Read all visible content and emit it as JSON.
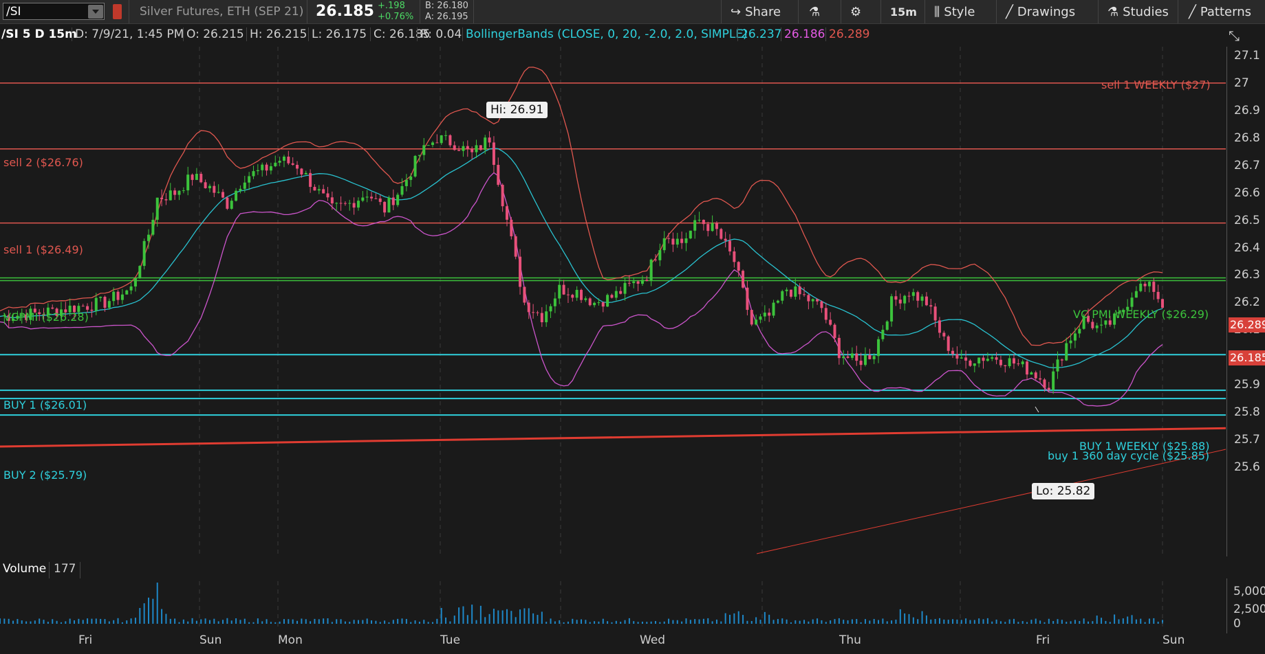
{
  "toolbar": {
    "symbol": "/SI",
    "description": "Silver Futures, ETH (SEP 21)",
    "last": "26.185",
    "change": "+.198",
    "change_pct": "+0.76%",
    "bid": "B: 26.180",
    "ask": "A: 26.195",
    "share_label": "Share",
    "timeframe_label": "15m",
    "style_label": "Style",
    "drawings_label": "Drawings",
    "studies_label": "Studies",
    "patterns_label": "Patterns",
    "icons": [
      "share-icon",
      "flask-icon",
      "gear-icon",
      "style-icon",
      "drawings-icon",
      "studies-icon",
      "patterns-icon"
    ]
  },
  "infobar": {
    "symbol_period": "/SI 5 D 15m",
    "date": "D: 7/9/21, 1:45 PM",
    "open": "O: 26.215",
    "high": "H: 26.215",
    "low": "L: 26.175",
    "close": "C: 26.185",
    "range": "R: 0.04",
    "study": "BollingerBands (CLOSE, 0, 20, -2.0, 2.0, SIMPLE)",
    "study_mid": "26.237",
    "study_lower": "26.186",
    "study_upper": "26.289"
  },
  "levels": {
    "sell1_weekly": "sell 1 WEEKLY ($27)",
    "sell2": "sell 2  ($26.76)",
    "sell1": "sell 1 ($26.49)",
    "vcpmi": "VCPMI ($26.28)",
    "vcpmi_weekly": "VC PMI WEEKLY ($26.29)",
    "buy1": "BUY 1 ($26.01)",
    "buy1_weekly": "BUY 1 WEEKLY ($25.88)",
    "buy1_cycle": "buy 1 360 day cycle  ($25.85)",
    "buy2": "BUY 2 ($25.79)"
  },
  "annotations": {
    "hi": "Hi: 26.91",
    "lo": "Lo: 25.82"
  },
  "price_tags": {
    "upper": "26.289",
    "last": "26.185"
  },
  "volume": {
    "label": "Volume",
    "count": "177",
    "ticks": [
      "5,000",
      "2,500",
      "0"
    ]
  },
  "colors": {
    "upper_band": "#e0574f",
    "middle_band": "#29c2d0",
    "lower_band": "#cc55cc",
    "sell": "#e0574f",
    "buy": "#2fd0dc",
    "vcpmi": "#3cc33c",
    "trendline": "#e03c31",
    "up_candle": "#3cc33c",
    "down_candle": "#e8507a"
  },
  "chart_data": {
    "type": "candlestick",
    "ylim": [
      25.57,
      27.15
    ],
    "y_ticks": [
      "27.1",
      "27",
      "26.9",
      "26.8",
      "26.7",
      "26.6",
      "26.5",
      "26.4",
      "26.3",
      "26.2",
      "26.1",
      "26",
      "25.9",
      "25.8",
      "25.7",
      "25.6"
    ],
    "x_labels": [
      "Fri",
      "Sun",
      "Mon",
      "Tue",
      "Wed",
      "Thu",
      "Fri",
      "Sun"
    ],
    "horizontal_levels": [
      27.0,
      26.76,
      26.49,
      26.28,
      26.29,
      26.01,
      25.88,
      25.85,
      25.79
    ],
    "close_path": [
      [
        0,
        26.15
      ],
      [
        8,
        26.16
      ],
      [
        16,
        26.18
      ],
      [
        24,
        26.2
      ],
      [
        30,
        26.25
      ],
      [
        34,
        26.45
      ],
      [
        36,
        26.58
      ],
      [
        40,
        26.6
      ],
      [
        44,
        26.66
      ],
      [
        48,
        26.62
      ],
      [
        52,
        26.56
      ],
      [
        56,
        26.66
      ],
      [
        60,
        26.68
      ],
      [
        64,
        26.72
      ],
      [
        68,
        26.7
      ],
      [
        72,
        26.62
      ],
      [
        76,
        26.54
      ],
      [
        80,
        26.56
      ],
      [
        84,
        26.6
      ],
      [
        88,
        26.54
      ],
      [
        92,
        26.62
      ],
      [
        96,
        26.74
      ],
      [
        100,
        26.8
      ],
      [
        104,
        26.78
      ],
      [
        108,
        26.74
      ],
      [
        112,
        26.8
      ],
      [
        116,
        26.5
      ],
      [
        120,
        26.2
      ],
      [
        124,
        26.15
      ],
      [
        128,
        26.25
      ],
      [
        132,
        26.24
      ],
      [
        136,
        26.2
      ],
      [
        140,
        26.22
      ],
      [
        144,
        26.26
      ],
      [
        148,
        26.3
      ],
      [
        152,
        26.45
      ],
      [
        156,
        26.42
      ],
      [
        160,
        26.5
      ],
      [
        164,
        26.46
      ],
      [
        168,
        26.35
      ],
      [
        172,
        26.12
      ],
      [
        176,
        26.15
      ],
      [
        180,
        26.25
      ],
      [
        184,
        26.22
      ],
      [
        188,
        26.18
      ],
      [
        192,
        26.02
      ],
      [
        196,
        25.98
      ],
      [
        200,
        26.02
      ],
      [
        204,
        26.2
      ],
      [
        208,
        26.24
      ],
      [
        212,
        26.2
      ],
      [
        216,
        26.06
      ],
      [
        220,
        25.98
      ],
      [
        224,
        26.0
      ],
      [
        228,
        26.0
      ],
      [
        232,
        25.98
      ],
      [
        236,
        25.95
      ],
      [
        240,
        25.9
      ],
      [
        244,
        26.05
      ],
      [
        248,
        26.14
      ],
      [
        252,
        26.1
      ],
      [
        256,
        26.15
      ],
      [
        260,
        26.26
      ],
      [
        264,
        26.25
      ],
      [
        266,
        26.19
      ]
    ],
    "volume_peak": 5800
  }
}
